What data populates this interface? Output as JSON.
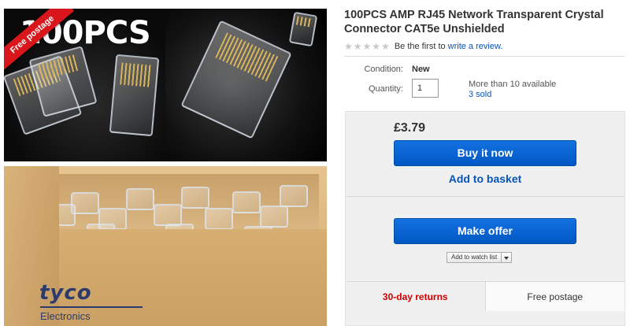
{
  "gallery": {
    "badge": "Free postage",
    "count_text": "100PCS",
    "brand_mark": "tyco",
    "brand_sub": "Electronics"
  },
  "product": {
    "title": "100PCS AMP RJ45 Network Transparent Crystal Connector CAT5e Unshielded",
    "rating_prefix": "Be the first to",
    "review_link": "write a review."
  },
  "details": {
    "condition_label": "Condition:",
    "condition_value": "New",
    "quantity_label": "Quantity:",
    "quantity_value": "1",
    "availability": "More than 10 available",
    "sold": "3 sold"
  },
  "buybox": {
    "price": "£3.79",
    "buy_now": "Buy it now",
    "add_basket": "Add to basket",
    "make_offer": "Make offer",
    "watch_list": "Add to watch list",
    "returns": "30-day returns",
    "postage": "Free postage"
  },
  "colors": {
    "primary_button": "#0063d1",
    "link": "#0654ba",
    "returns_red": "#c00000",
    "badge_red": "#d8161c"
  }
}
